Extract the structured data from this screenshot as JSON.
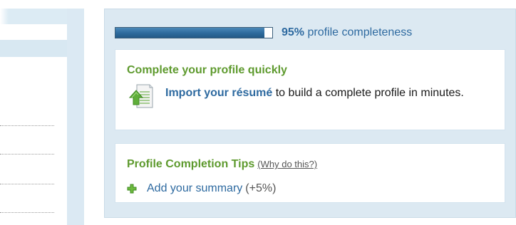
{
  "progress": {
    "fraction": 0.95,
    "percent_label": "95%",
    "label": "profile completeness"
  },
  "import_card": {
    "title": "Complete your profile quickly",
    "link_text": "Import your résumé",
    "rest_text": " to build a complete profile in minutes.",
    "icon": "import-document-icon"
  },
  "tips_card": {
    "title": "Profile Completion Tips",
    "why_link": "(Why do this?)",
    "tips": [
      {
        "icon": "plus-icon",
        "label": "Add your summary",
        "extra": "(+5%)"
      }
    ]
  },
  "colors": {
    "panel_bg": "#dce9f2",
    "accent_blue": "#2e6aa0",
    "title_green": "#5e9a2e",
    "progress_fill": "#2d6a9c"
  }
}
